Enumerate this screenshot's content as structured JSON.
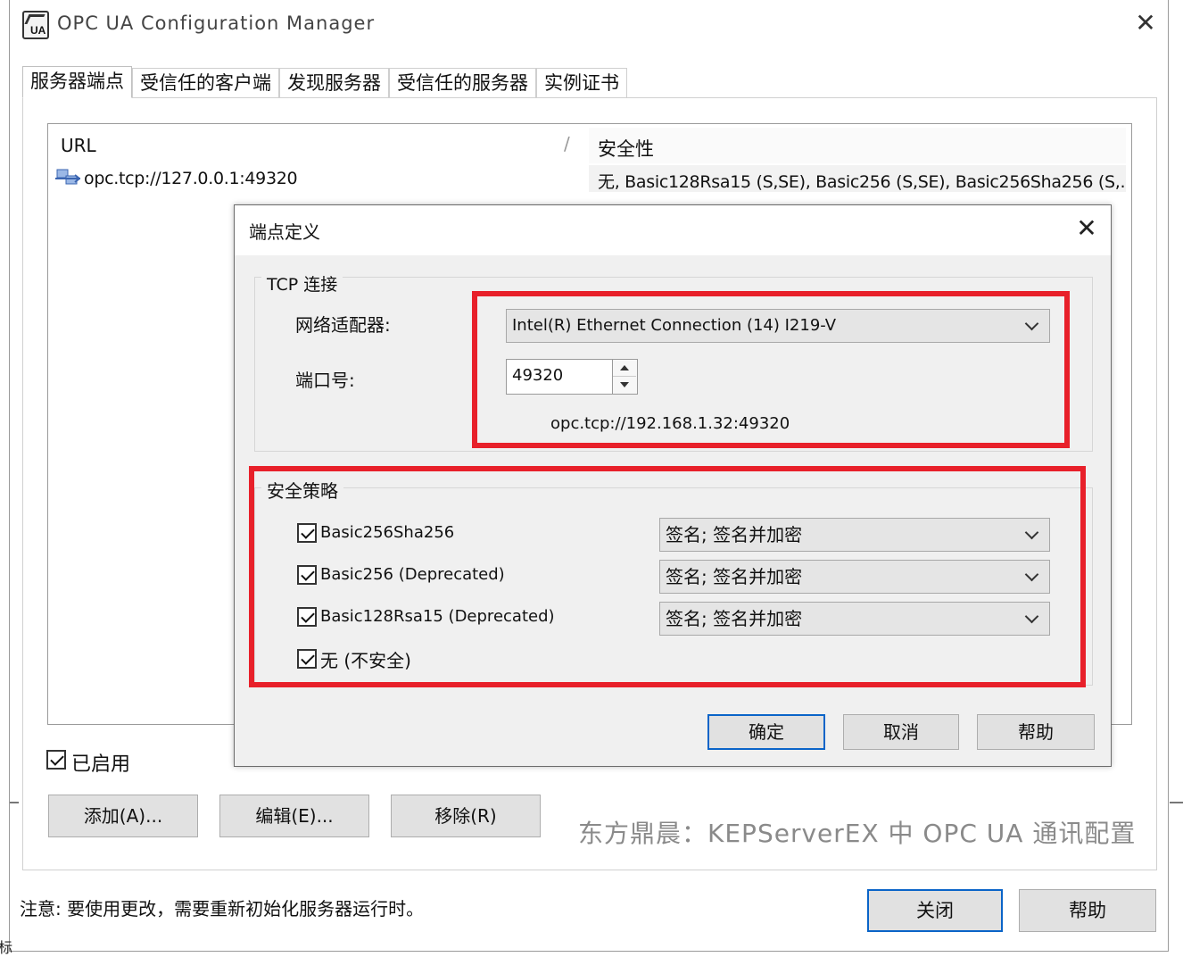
{
  "window": {
    "title": "OPC UA Configuration Manager",
    "close_glyph": "✕"
  },
  "tabs": [
    {
      "label": "服务器端点",
      "active": true
    },
    {
      "label": "受信任的客户端",
      "active": false
    },
    {
      "label": "发现服务器",
      "active": false
    },
    {
      "label": "受信任的服务器",
      "active": false
    },
    {
      "label": "实例证书",
      "active": false
    }
  ],
  "endpoint_list": {
    "columns": {
      "url": "URL",
      "separator": "/",
      "security": "安全性"
    },
    "rows": [
      {
        "icon": "network-endpoint-icon",
        "url": "opc.tcp://127.0.0.1:49320",
        "security": "无, Basic128Rsa15 (S,SE), Basic256 (S,SE), Basic256Sha256 (S,..."
      }
    ]
  },
  "enabled": {
    "label": "已启用",
    "checked": true
  },
  "buttons": {
    "add": "添加(A)...",
    "edit": "编辑(E)...",
    "remove": "移除(R)",
    "close": "关闭",
    "help": "帮助"
  },
  "watermark": "东方鼎晨：KEPServerEX 中 OPC UA 通讯配置",
  "note": "注意: 要使用更改，需要重新初始化服务器运行时。",
  "edge_text": "标",
  "dialog": {
    "title": "端点定义",
    "close_glyph": "✕",
    "tcp": {
      "legend": "TCP 连接",
      "adapter_label": "网络适配器:",
      "adapter_value": "Intel(R) Ethernet Connection (14) I219-V",
      "port_label": "端口号:",
      "port_value": "49320",
      "endpoint_url": "opc.tcp://192.168.1.32:49320"
    },
    "security": {
      "legend": "安全策略",
      "policies": [
        {
          "label": "Basic256Sha256",
          "checked": true,
          "mode": "签名; 签名并加密"
        },
        {
          "label": "Basic256 (Deprecated)",
          "checked": true,
          "mode": "签名; 签名并加密"
        },
        {
          "label": "Basic128Rsa15 (Deprecated)",
          "checked": true,
          "mode": "签名; 签名并加密"
        }
      ],
      "none_label": "无 (不安全)",
      "none_checked": true
    },
    "buttons": {
      "ok": "确定",
      "cancel": "取消",
      "help": "帮助"
    }
  },
  "colors": {
    "highlight": "#e8202a",
    "focus_border": "#0a64c8",
    "dialog_bg": "#f0f0f0",
    "button_bg": "#e1e1e1"
  }
}
